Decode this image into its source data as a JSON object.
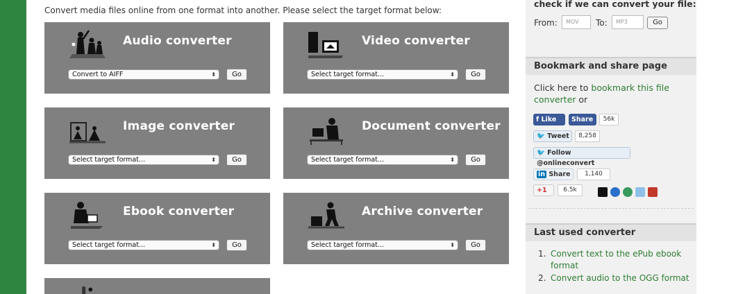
{
  "intro": "Convert media files online from one format into another. Please select the target format below:",
  "converters": [
    {
      "title": "Audio converter",
      "select": "Convert to AIFF",
      "go": "Go"
    },
    {
      "title": "Video converter",
      "select": "Select target format...",
      "go": "Go"
    },
    {
      "title": "Image converter",
      "select": "Select target format...",
      "go": "Go"
    },
    {
      "title": "Document converter",
      "select": "Select target format...",
      "go": "Go"
    },
    {
      "title": "Ebook converter",
      "select": "Select target format...",
      "go": "Go"
    },
    {
      "title": "Archive converter",
      "select": "Select target format...",
      "go": "Go"
    }
  ],
  "sidebar": {
    "check": {
      "text": "check if we can convert your file:",
      "from_label": "From:",
      "from_placeholder": "MOV",
      "to_label": "To:",
      "to_placeholder": "MP3",
      "go": "Go"
    },
    "bookmark": {
      "heading": "Bookmark and share page",
      "text_prefix": "Click here to ",
      "link": "bookmark this file converter",
      "text_suffix": " or",
      "like": "Like",
      "share": "Share",
      "fb_count": "56k",
      "tweet": "Tweet",
      "tweet_count": "8,258",
      "follow": "Follow @onlineconvert",
      "li_share": "Share",
      "li_count": "1,140",
      "gplus": "+1",
      "gplus_count": "6.5k"
    },
    "last_used": {
      "heading": "Last used converter",
      "items": [
        {
          "num": "1.",
          "label": "Convert text to the ePub ebook format"
        },
        {
          "num": "2.",
          "label": "Convert audio to the OGG format"
        }
      ]
    }
  }
}
